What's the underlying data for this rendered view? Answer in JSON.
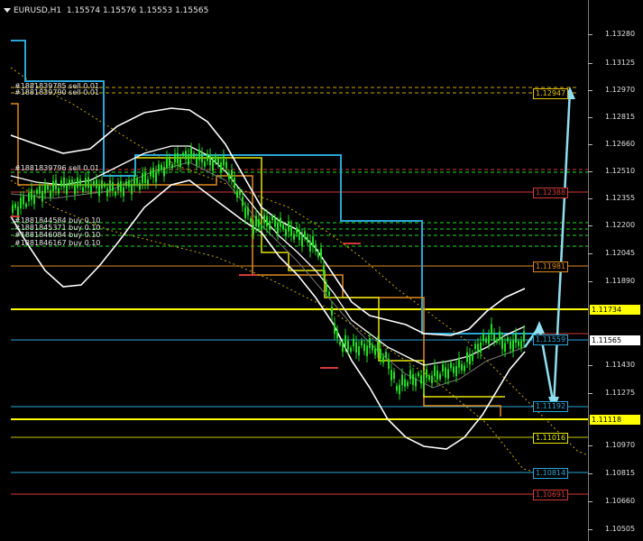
{
  "window": {
    "symbol_timeframe": "EURUSD,H1",
    "ohlc": "1.15574 1.15576 1.15553 1.15565"
  },
  "price_axis": {
    "ticks": [
      "1.13280",
      "1.13125",
      "1.12970",
      "1.12815",
      "1.12660",
      "1.12510",
      "1.12355",
      "1.12200",
      "1.12045",
      "1.11890",
      "1.11430",
      "1.11275",
      "1.10970",
      "1.10815",
      "1.10660",
      "1.10505"
    ],
    "tags": [
      {
        "text": "1.11734",
        "bg": "#ffff00",
        "color": "#000000"
      },
      {
        "text": "1.11565",
        "bg": "#ffffff",
        "color": "#000000"
      },
      {
        "text": "1.11118",
        "bg": "#ffff00",
        "color": "#000000"
      }
    ]
  },
  "order_labels": [
    "#1881839785 sell 0.01",
    "#1881839790 sell 0.01",
    "#1881839796 sell 0.01",
    "#1881844584 buy 0.10",
    "#1881845371 buy 0.10",
    "#1881846084 buy 0.10",
    "#1881846167 buy 0.10"
  ],
  "level_boxes": [
    {
      "text": "1.12947",
      "color": "#e6c200"
    },
    {
      "text": "1.12388",
      "color": "#d43a3a"
    },
    {
      "text": "1.11981",
      "color": "#e08a20"
    },
    {
      "text": "1.11559",
      "color": "#2aa6d6"
    },
    {
      "text": "1.11192",
      "color": "#2aa6d6"
    },
    {
      "text": "1.11016",
      "color": "#e6e600"
    },
    {
      "text": "1.10814",
      "color": "#2aa6d6"
    },
    {
      "text": "1.10691",
      "color": "#d43a3a"
    }
  ],
  "colors": {
    "candles": "#22dd22",
    "bands": "#ffffff",
    "arrows": "#8fe0f0",
    "blue_step": "#2aa6d6",
    "orange_step": "#e08a20",
    "yellow_step": "#e6e600",
    "dotted_ma": "#c8a800"
  }
}
